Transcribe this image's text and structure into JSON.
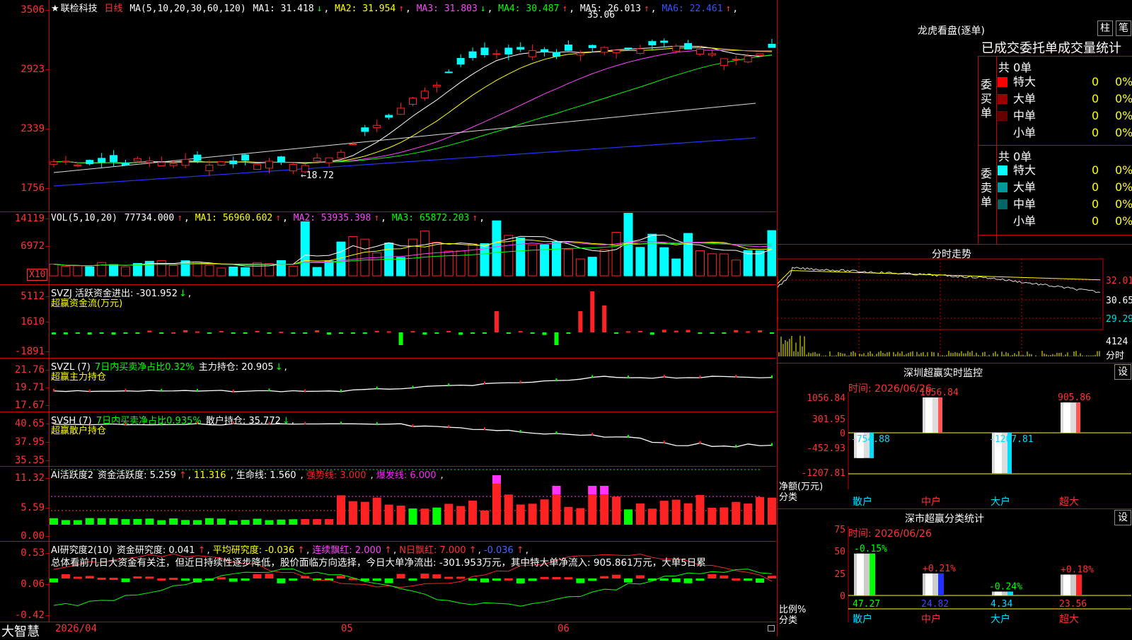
{
  "app_name": "大智慧",
  "stock": {
    "star": "★",
    "name": "联检科技",
    "period": "日线"
  },
  "ma_header": {
    "label": "MA(5,10,20,30,60,120)",
    "items": [
      {
        "text": "MA1: 31.418",
        "arrow": "↓",
        "color": "#ffffff"
      },
      {
        "text": "MA2: 31.954",
        "arrow": "↑",
        "color": "#ffff00"
      },
      {
        "text": "MA3: 31.803",
        "arrow": "↓",
        "color": "#ff44ff"
      },
      {
        "text": "MA4: 30.487",
        "arrow": "↑",
        "color": "#00ff00"
      },
      {
        "text": "MA5: 26.013",
        "arrow": "↑",
        "color": "#ffffff"
      },
      {
        "text": "MA6: 22.461",
        "arrow": "↑",
        "color": "#3355ff"
      }
    ]
  },
  "price_axis": [
    "3506",
    "2923",
    "2339",
    "1756"
  ],
  "price_marks": {
    "high": "35.06",
    "low": "18.72"
  },
  "vol_header": {
    "label": "VOL(5,10,20)",
    "items": [
      {
        "text": "77734.000",
        "arrow": "↑",
        "color": "#ffffff"
      },
      {
        "text": "MA1: 56960.602",
        "arrow": "↑",
        "color": "#ffff00"
      },
      {
        "text": "MA2: 53935.398",
        "arrow": "↑",
        "color": "#ff44ff"
      },
      {
        "text": "MA3: 65872.203",
        "arrow": "↑",
        "color": "#00ff00"
      }
    ]
  },
  "vol_axis": [
    "14119",
    "6972"
  ],
  "vol_unit": "X10",
  "svzj": {
    "title": "SVZJ  活跃资金进出: -301.952",
    "arrow": "↓",
    "subtitle": "超赢资金流(万元)",
    "axis": [
      "5112",
      "1610",
      "-1891"
    ]
  },
  "svzl": {
    "title": "SVZL (7)",
    "note": "7日内买卖净占比0.32%",
    "hold": "主力持仓: 20.905",
    "arrow": "↓",
    "subtitle": "超赢主力持仓",
    "axis": [
      "21.76",
      "19.71",
      "17.67"
    ]
  },
  "svsh": {
    "title": "SVSH (7)",
    "note": "7日内买卖净占比0.935%",
    "hold": "散户持仓: 35.772",
    "arrow": "↓",
    "subtitle": "超赢散户持仓",
    "axis": [
      "40.65",
      "37.95",
      "35.35"
    ]
  },
  "ai_active": {
    "title": "AI活跃度2",
    "items": [
      {
        "text": "资金活跃度: 5.259",
        "arrow": "↑",
        "color": "#ffffff"
      },
      {
        "text": "11.316",
        "arrow": "",
        "color": "#ffff00"
      },
      {
        "text": "生命线: 1.560",
        "arrow": "",
        "color": "#ffffff"
      },
      {
        "text": "强势线: 3.000",
        "arrow": "",
        "color": "#ff2222"
      },
      {
        "text": "爆发线: 6.000",
        "arrow": "",
        "color": "#ff22ff"
      }
    ],
    "axis": [
      "11.32",
      "5.59",
      "0.00"
    ]
  },
  "ai_research": {
    "title": "AI研究度2(10)",
    "items": [
      {
        "text": "资金研究度: 0.041",
        "arrow": "↑",
        "color": "#ffffff"
      },
      {
        "text": "平均研究度: -0.036",
        "arrow": "↑",
        "color": "#ffff00"
      },
      {
        "text": "连续飘红: 2.000",
        "arrow": "↑",
        "color": "#ff44ff"
      },
      {
        "text": "N日飘红: 7.000",
        "arrow": "↑",
        "color": "#ff3333"
      },
      {
        "text": "-0.036",
        "arrow": "↑",
        "color": "#4466ff"
      }
    ],
    "comment": "总体看前几日大资金有关注，但近日持续性逐步降低，股价面临方向选择，今日大单净流出: -301.953万元，其中特大单净流入: 905.861万元，大单5日累",
    "axis": [
      "0.53",
      "0.06",
      "-0.42"
    ]
  },
  "date_axis": [
    "2026/04",
    "05",
    "06"
  ],
  "longhu": {
    "title": "龙虎看盘(逐单)",
    "tab_bar": "柱",
    "tab_tick": "笔",
    "table_title": "已成交委托单成交量统计",
    "buy": {
      "label": "委买单",
      "total": "共 0单",
      "rows": [
        {
          "name": "特大",
          "value": "0",
          "pct": "0%",
          "color": "#ff0000"
        },
        {
          "name": "大单",
          "value": "0",
          "pct": "0%",
          "color": "#990000"
        },
        {
          "name": "中单",
          "value": "0",
          "pct": "0%",
          "color": "#660000"
        },
        {
          "name": "小单",
          "value": "0",
          "pct": "0%",
          "color": "#000000"
        }
      ]
    },
    "sell": {
      "label": "委卖单",
      "total": "共 0单",
      "rows": [
        {
          "name": "特大",
          "value": "0",
          "pct": "0%",
          "color": "#00ffff"
        },
        {
          "name": "大单",
          "value": "0",
          "pct": "0%",
          "color": "#009999"
        },
        {
          "name": "中单",
          "value": "0",
          "pct": "0%",
          "color": "#006666"
        },
        {
          "name": "小单",
          "value": "0",
          "pct": "0%",
          "color": "#000000"
        }
      ]
    }
  },
  "intraday": {
    "title": "分时走势",
    "axis": [
      "32.01",
      "30.65",
      "29.29",
      "4124"
    ],
    "unit": "分时"
  },
  "monitor": {
    "title": "深圳超赢实时监控",
    "settings": "设",
    "time": "时间: 2026/06/26",
    "axis": [
      "1056.84",
      "301.95",
      "0",
      "-452.93",
      "-1207.81"
    ],
    "axis_title": "净额(万元)",
    "cat_title": "分类",
    "bars": [
      {
        "name": "散户",
        "value": -754.88,
        "label": "-754.88"
      },
      {
        "name": "中户",
        "value": 1056.84,
        "label": "1056.84"
      },
      {
        "name": "大户",
        "value": -1207.81,
        "label": "-1207.81"
      },
      {
        "name": "超大",
        "value": 905.86,
        "label": "905.86"
      }
    ]
  },
  "classify": {
    "title": "深市超赢分类统计",
    "settings": "设",
    "time": "时间: 2026/06/26",
    "axis": [
      "75",
      "50",
      "25",
      "0"
    ],
    "axis_title": "比例%",
    "cat_title": "分类",
    "bars": [
      {
        "name": "散户",
        "value": 47.27,
        "label": "47.27",
        "change": "-0.15%"
      },
      {
        "name": "中户",
        "value": 24.82,
        "label": "24.82",
        "change": "+0.21%"
      },
      {
        "name": "大户",
        "value": 4.34,
        "label": "4.34",
        "change": "-0.24%"
      },
      {
        "name": "超大",
        "value": 23.56,
        "label": "23.56",
        "change": "+0.18%"
      }
    ]
  }
}
